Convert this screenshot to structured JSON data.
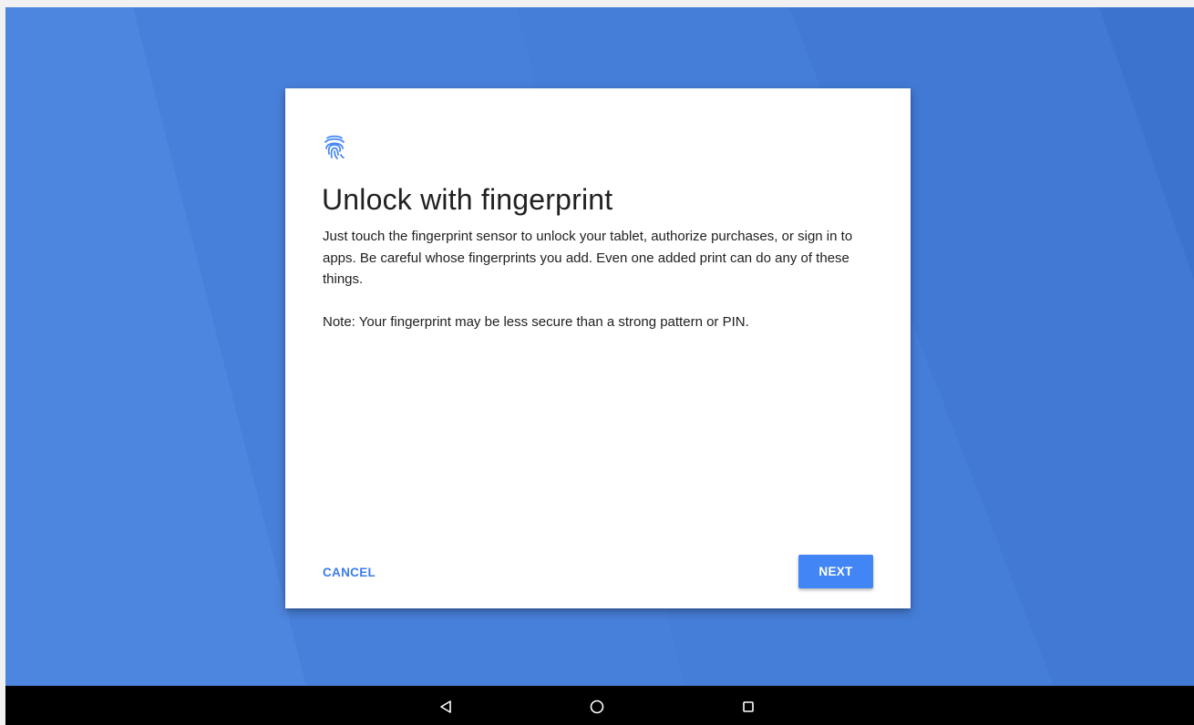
{
  "dialog": {
    "icon": "fingerprint-icon",
    "title": "Unlock with fingerprint",
    "body": "Just touch the fingerprint sensor to unlock your tablet, authorize purchases, or sign in to apps. Be careful whose fingerprints you add. Even one added print can do any of these things.",
    "note": "Note: Your fingerprint may be less secure than a strong pattern or PIN.",
    "cancel_label": "CANCEL",
    "next_label": "NEXT"
  },
  "navbar": {
    "buttons": [
      {
        "name": "back",
        "icon": "back-triangle-icon"
      },
      {
        "name": "home",
        "icon": "home-circle-icon"
      },
      {
        "name": "recents",
        "icon": "recents-square-icon"
      }
    ]
  },
  "colors": {
    "wallpaper": "#4a82dc",
    "accent": "#4285f4",
    "link": "#3a7ee8",
    "navbar": "#000000",
    "dialog": "#ffffff"
  }
}
